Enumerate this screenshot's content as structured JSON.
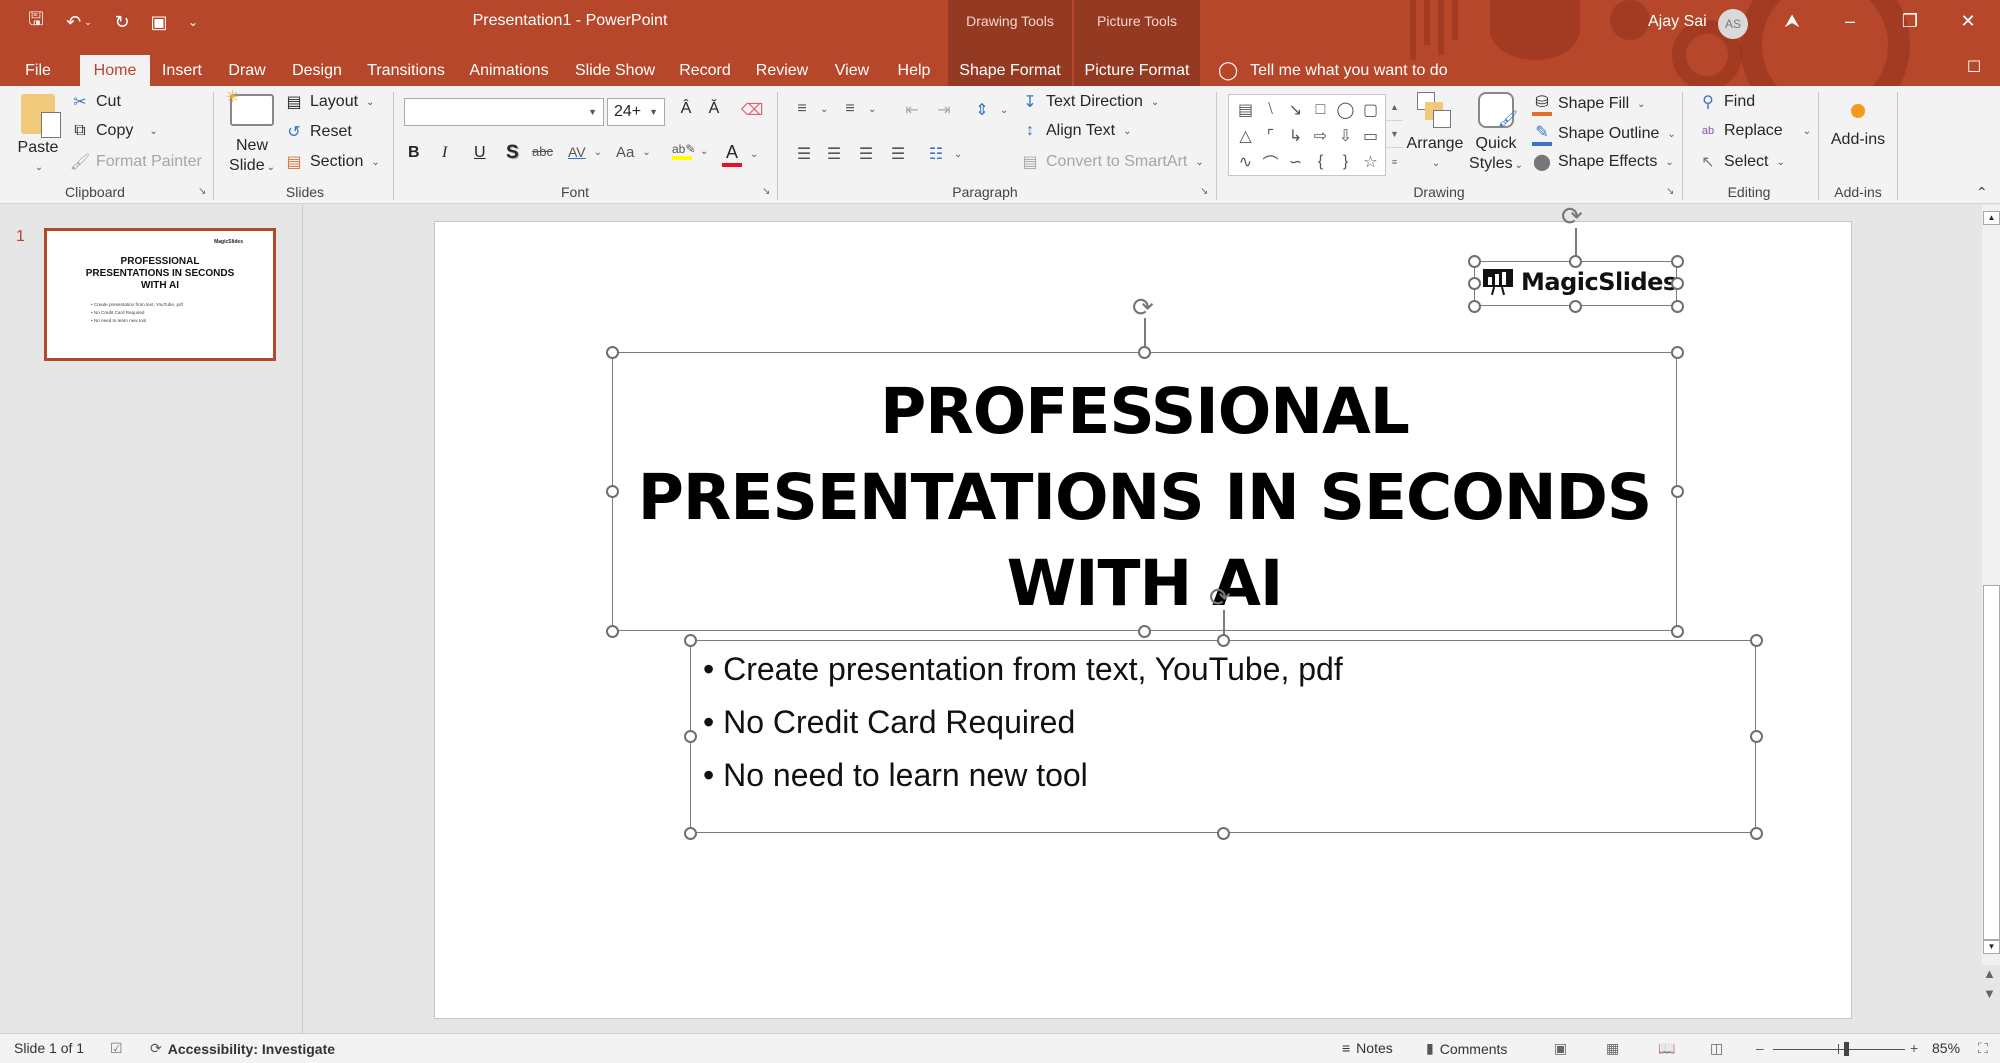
{
  "app": {
    "document_title": "Presentation1  -  PowerPoint",
    "user_name": "Ajay Sai",
    "user_initials": "AS",
    "accent_color": "#b7472a"
  },
  "quick_access": {
    "save": "save-icon",
    "undo": "undo-icon",
    "redo": "redo-icon",
    "present": "present-from-beginning-icon",
    "customize": "customize-qat-icon"
  },
  "context_groups": {
    "drawing_tools": "Drawing Tools",
    "picture_tools": "Picture Tools"
  },
  "tabs": [
    {
      "label": "File"
    },
    {
      "label": "Home",
      "active": true
    },
    {
      "label": "Insert"
    },
    {
      "label": "Draw"
    },
    {
      "label": "Design"
    },
    {
      "label": "Transitions"
    },
    {
      "label": "Animations"
    },
    {
      "label": "Slide Show"
    },
    {
      "label": "Record"
    },
    {
      "label": "Review"
    },
    {
      "label": "View"
    },
    {
      "label": "Help"
    },
    {
      "label": "Shape Format"
    },
    {
      "label": "Picture Format"
    }
  ],
  "tell_me": "Tell me what you want to do",
  "ribbon": {
    "clipboard": {
      "label": "Clipboard",
      "paste": "Paste",
      "cut": "Cut",
      "copy": "Copy",
      "format_painter": "Format Painter"
    },
    "slides": {
      "label": "Slides",
      "new_slide_1": "New",
      "new_slide_2": "Slide",
      "layout": "Layout",
      "reset": "Reset",
      "section": "Section"
    },
    "font": {
      "label": "Font",
      "font_name": "",
      "font_size": "24+",
      "bold": "B",
      "italic": "I",
      "underline": "U",
      "shadow": "S",
      "strike": "abc",
      "spacing": "AV",
      "change_case": "Aa",
      "highlight_color": "#ffff00",
      "font_color": "#e81123"
    },
    "paragraph": {
      "label": "Paragraph",
      "text_direction": "Text Direction",
      "align_text": "Align Text",
      "convert_smartart": "Convert to SmartArt"
    },
    "drawing": {
      "label": "Drawing",
      "arrange": "Arrange",
      "quick_styles_1": "Quick",
      "quick_styles_2": "Styles",
      "shape_fill": "Shape Fill",
      "shape_outline": "Shape Outline",
      "shape_effects": "Shape Effects"
    },
    "editing": {
      "label": "Editing",
      "find": "Find",
      "replace": "Replace",
      "select": "Select"
    },
    "addins": {
      "label": "Add-ins",
      "button": "Add-ins"
    }
  },
  "thumbnails": [
    {
      "number": "1",
      "title": "PROFESSIONAL PRESENTATIONS IN SECONDS WITH AI",
      "logo": "MagicSlides",
      "bullets": [
        "Create presentation from text, YouTube, pdf",
        "No Credit Card Required",
        "No need to learn new tool"
      ]
    }
  ],
  "slide": {
    "logo_text": "MagicSlides",
    "title_lines": [
      "PROFESSIONAL",
      "PRESENTATIONS IN SECONDS",
      "WITH AI"
    ],
    "bullets": [
      "Create presentation from text, YouTube, pdf",
      "No Credit Card Required",
      "No need to learn new tool"
    ]
  },
  "status": {
    "slide_count": "Slide 1 of 1",
    "accessibility": "Accessibility: Investigate",
    "notes": "Notes",
    "comments": "Comments",
    "zoom": "85%",
    "zoom_fraction": 0.55
  }
}
